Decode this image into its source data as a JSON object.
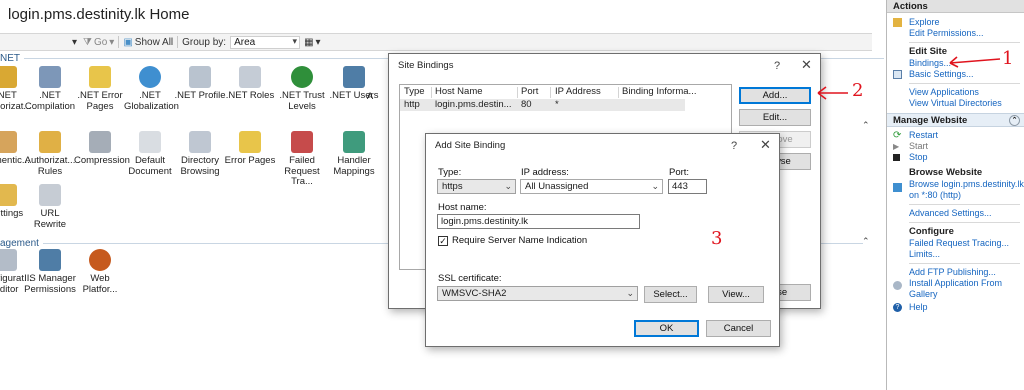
{
  "page": {
    "title": "login.pms.destinity.lk Home"
  },
  "toolbar": {
    "go_label": "Go",
    "show_all_label": "Show All",
    "group_by_label": "Group by:",
    "group_by_value": "Area"
  },
  "groups": {
    "net_label": "NET",
    "iis_label": "",
    "management_label": "agement"
  },
  "features": {
    "row1": [
      ".NET Authorizat...",
      ".NET Compilation",
      ".NET Error Pages",
      ".NET Globalization",
      ".NET Profile",
      ".NET Roles",
      ".NET Trust Levels",
      ".NET Users",
      "A"
    ],
    "row2": [
      "Authentic...",
      "Authorizat... Rules",
      "Compression",
      "Default Document",
      "Directory Browsing",
      "Error Pages",
      "Failed Request Tra...",
      "Handler Mappings"
    ],
    "row3": [
      "Settings",
      "URL Rewrite"
    ],
    "row4": [
      "Configurat... Editor",
      "IIS Manager Permissions",
      "Web Platfor..."
    ]
  },
  "actions": {
    "header": "Actions",
    "explore": "Explore",
    "edit_permissions": "Edit Permissions...",
    "edit_site": "Edit Site",
    "bindings": "Bindings...",
    "basic_settings": "Basic Settings...",
    "view_applications": "View Applications",
    "view_virtual_directories": "View Virtual Directories",
    "manage_website": "Manage Website",
    "restart": "Restart",
    "start": "Start",
    "stop": "Stop",
    "browse_website": "Browse Website",
    "browse_link": "Browse login.pms.destinity.lk on *:80 (http)",
    "advanced_settings": "Advanced Settings...",
    "configure": "Configure",
    "failed_request_tracing": "Failed Request Tracing...",
    "limits": "Limits...",
    "add_ftp_publishing": "Add FTP Publishing...",
    "install_application": "Install Application From Gallery",
    "help": "Help"
  },
  "site_bindings": {
    "title": "Site Bindings",
    "help_glyph": "?",
    "close_glyph": "✕",
    "columns": [
      "Type",
      "Host Name",
      "Port",
      "IP Address",
      "Binding Informa..."
    ],
    "rows": [
      {
        "type": "http",
        "host": "login.pms.destin...",
        "port": "80",
        "ip": "*",
        "info": ""
      }
    ],
    "add_button": "Add...",
    "edit_button": "Edit...",
    "remove_button": "Remove",
    "browse_button": "Browse",
    "close_button": "Close"
  },
  "add_binding": {
    "title": "Add Site Binding",
    "help_glyph": "?",
    "close_glyph": "✕",
    "type_label": "Type:",
    "type_value": "https",
    "ip_label": "IP address:",
    "ip_value": "All Unassigned",
    "port_label": "Port:",
    "port_value": "443",
    "host_label": "Host name:",
    "host_value": "login.pms.destinity.lk",
    "sni_label": "Require Server Name Indication",
    "sni_checked": true,
    "ssl_label": "SSL certificate:",
    "ssl_value": "WMSVC-SHA2",
    "select_button": "Select...",
    "view_button": "View...",
    "ok_button": "OK",
    "cancel_button": "Cancel"
  },
  "annotations": {
    "one": "1",
    "two": "2",
    "three": "3"
  },
  "colors": {
    "link": "#1565c0",
    "accent": "#0078d7",
    "annotation": "#e0141e"
  }
}
